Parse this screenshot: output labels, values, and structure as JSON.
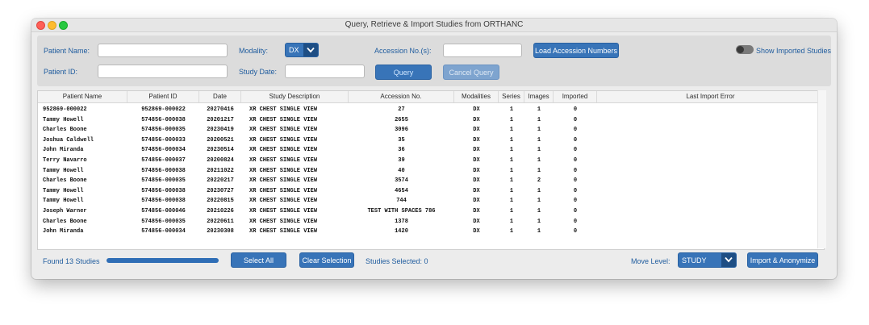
{
  "window": {
    "title": "Query, Retrieve & Import Studies from ORTHANC"
  },
  "form": {
    "patient_name_label": "Patient Name:",
    "patient_id_label": "Patient ID:",
    "modality_label": "Modality:",
    "modality_value": "DX",
    "study_date_label": "Study Date:",
    "accession_label": "Accession No.(s):",
    "patient_name_value": "",
    "patient_id_value": "",
    "study_date_value": "",
    "accession_value": "",
    "load_accession_label": "Load Accession Numbers",
    "query_label": "Query",
    "cancel_query_label": "Cancel Query",
    "show_imported_label": "Show Imported Studies",
    "show_imported_on": false
  },
  "table": {
    "columns": [
      "Patient Name",
      "Patient ID",
      "Date",
      "Study Description",
      "Accession No.",
      "Modalities",
      "Series",
      "Images",
      "Imported",
      "Last Import Error"
    ],
    "rows": [
      [
        "952869-000022",
        "952869-000022",
        "20270416",
        "XR CHEST SINGLE VIEW",
        "27",
        "DX",
        "1",
        "1",
        "0",
        ""
      ],
      [
        "Tammy Howell",
        "574856-000038",
        "20201217",
        "XR CHEST SINGLE VIEW",
        "2655",
        "DX",
        "1",
        "1",
        "0",
        ""
      ],
      [
        "Charles Boone",
        "574856-000035",
        "20230419",
        "XR CHEST SINGLE VIEW",
        "3096",
        "DX",
        "1",
        "1",
        "0",
        ""
      ],
      [
        "Joshua Caldwell",
        "574856-000033",
        "20200521",
        "XR CHEST SINGLE VIEW",
        "35",
        "DX",
        "1",
        "1",
        "0",
        ""
      ],
      [
        "John Miranda",
        "574856-000034",
        "20230514",
        "XR CHEST SINGLE VIEW",
        "36",
        "DX",
        "1",
        "1",
        "0",
        ""
      ],
      [
        "Terry Navarro",
        "574856-000037",
        "20200824",
        "XR CHEST SINGLE VIEW",
        "39",
        "DX",
        "1",
        "1",
        "0",
        ""
      ],
      [
        "Tammy Howell",
        "574856-000038",
        "20211022",
        "XR CHEST SINGLE VIEW",
        "40",
        "DX",
        "1",
        "1",
        "0",
        ""
      ],
      [
        "Charles Boone",
        "574856-000035",
        "20220217",
        "XR CHEST SINGLE VIEW",
        "3574",
        "DX",
        "1",
        "2",
        "0",
        ""
      ],
      [
        "Tammy Howell",
        "574856-000038",
        "20230727",
        "XR CHEST SINGLE VIEW",
        "4654",
        "DX",
        "1",
        "1",
        "0",
        ""
      ],
      [
        "Tammy Howell",
        "574856-000038",
        "20220815",
        "XR CHEST SINGLE VIEW",
        "744",
        "DX",
        "1",
        "1",
        "0",
        ""
      ],
      [
        "Joseph Warner",
        "574856-000046",
        "20210226",
        "XR CHEST SINGLE VIEW",
        "TEST WITH SPACES 786",
        "DX",
        "1",
        "1",
        "0",
        ""
      ],
      [
        "Charles Boone",
        "574856-000035",
        "20220611",
        "XR CHEST SINGLE VIEW",
        "1378",
        "DX",
        "1",
        "1",
        "0",
        ""
      ],
      [
        "John Miranda",
        "574856-000034",
        "20230308",
        "XR CHEST SINGLE VIEW",
        "1420",
        "DX",
        "1",
        "1",
        "0",
        ""
      ]
    ]
  },
  "footer": {
    "found_text": "Found 13 Studies",
    "progress": 1.0,
    "select_all_label": "Select All",
    "clear_selection_label": "Clear Selection",
    "selected_text": "Studies Selected: 0",
    "move_level_label": "Move Level:",
    "move_level_value": "STUDY",
    "import_label": "Import & Anonymize"
  },
  "colors": {
    "accent": "#3874b8",
    "label": "#1f5c9e"
  },
  "icons": {
    "dropdown": "chevron-down-icon"
  }
}
